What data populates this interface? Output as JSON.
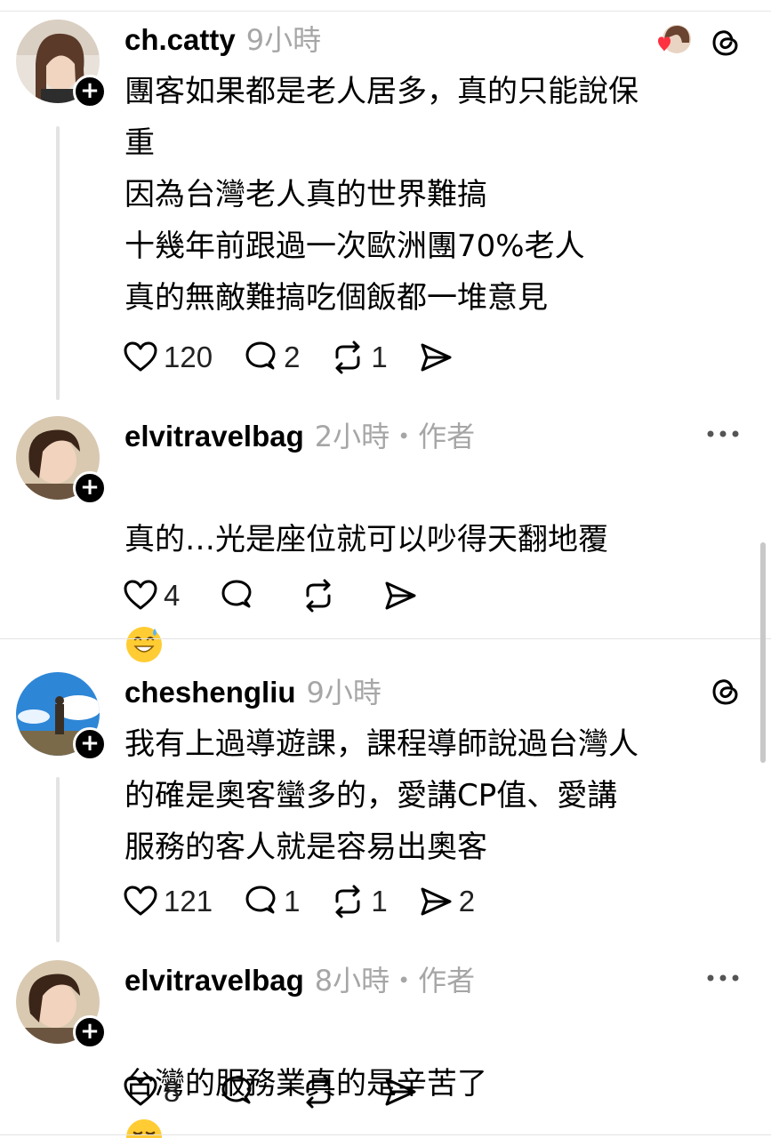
{
  "top_partial_text": "",
  "posts": [
    {
      "username": "ch.catty",
      "time": "9小時",
      "text": "團客如果都是老人居多，真的只能說保\n重\n因為台灣老人真的世界難搞\n十幾年前跟過一次歐洲團70%老人\n真的無敵難搞吃個飯都一堆意見",
      "likes": "120",
      "replies": "2",
      "reposts": "1",
      "shares": ""
    },
    {
      "username": "elvitravelbag",
      "time": "2小時・作者",
      "text": "真的…光是座位就可以吵得天翻地覆",
      "emoji": "grinning-face-with-sweat",
      "likes": "4",
      "replies": "",
      "reposts": "",
      "shares": ""
    },
    {
      "username": "cheshengliu",
      "time": "9小時",
      "text": "我有上過導遊課，課程導師說過台灣人\n的確是奧客蠻多的，愛講CP值、愛講\n服務的客人就是容易出奧客",
      "likes": "121",
      "replies": "1",
      "reposts": "1",
      "shares": "2"
    },
    {
      "username": "elvitravelbag",
      "time": "8小時・作者",
      "text": "台灣的服務業真的是辛苦了",
      "emoji": "face-exhaling",
      "likes": "8",
      "replies": "",
      "reposts": "",
      "shares": ""
    }
  ],
  "colors": {
    "like_heart": "#ff3040",
    "muted": "#a6a6a6",
    "divider": "#e3e3e3"
  }
}
